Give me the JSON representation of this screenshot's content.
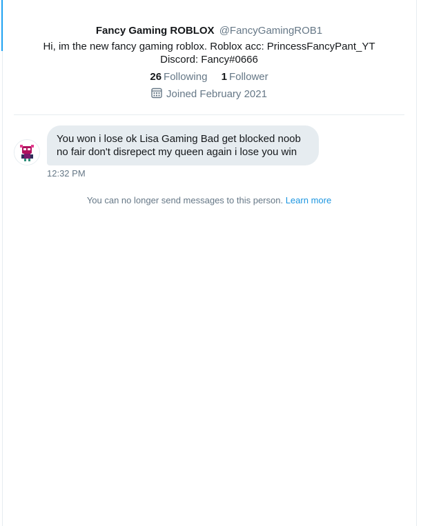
{
  "profile": {
    "display_name": "Fancy Gaming ROBLOX",
    "handle": "@FancyGamingROB1",
    "bio_line1": "Hi, im the new fancy gaming roblox. Roblox acc: PrincessFancyPant_YT",
    "bio_line2": "Discord: Fancy#0666",
    "following_count": "26",
    "following_label": "Following",
    "followers_count": "1",
    "followers_label": "Follower",
    "joined": "Joined February 2021",
    "joined_icon": "calendar-icon"
  },
  "conversation": {
    "messages": [
      {
        "line1": "You won i lose ok Lisa Gaming Bad get blocked noob",
        "line2": "no fair don't disrepect my queen again i lose you win",
        "time": "12:32 PM",
        "avatar_icon": "robot-avatar-icon"
      }
    ],
    "notice_text": "You can no longer send messages to this person.",
    "notice_link": "Learn more"
  },
  "colors": {
    "accent": "#1da1f2",
    "link": "#1b95e0",
    "secondary_text": "#657786",
    "primary_text": "#14171a",
    "bubble": "#e6ecf0",
    "divider": "#e6ecf0"
  }
}
